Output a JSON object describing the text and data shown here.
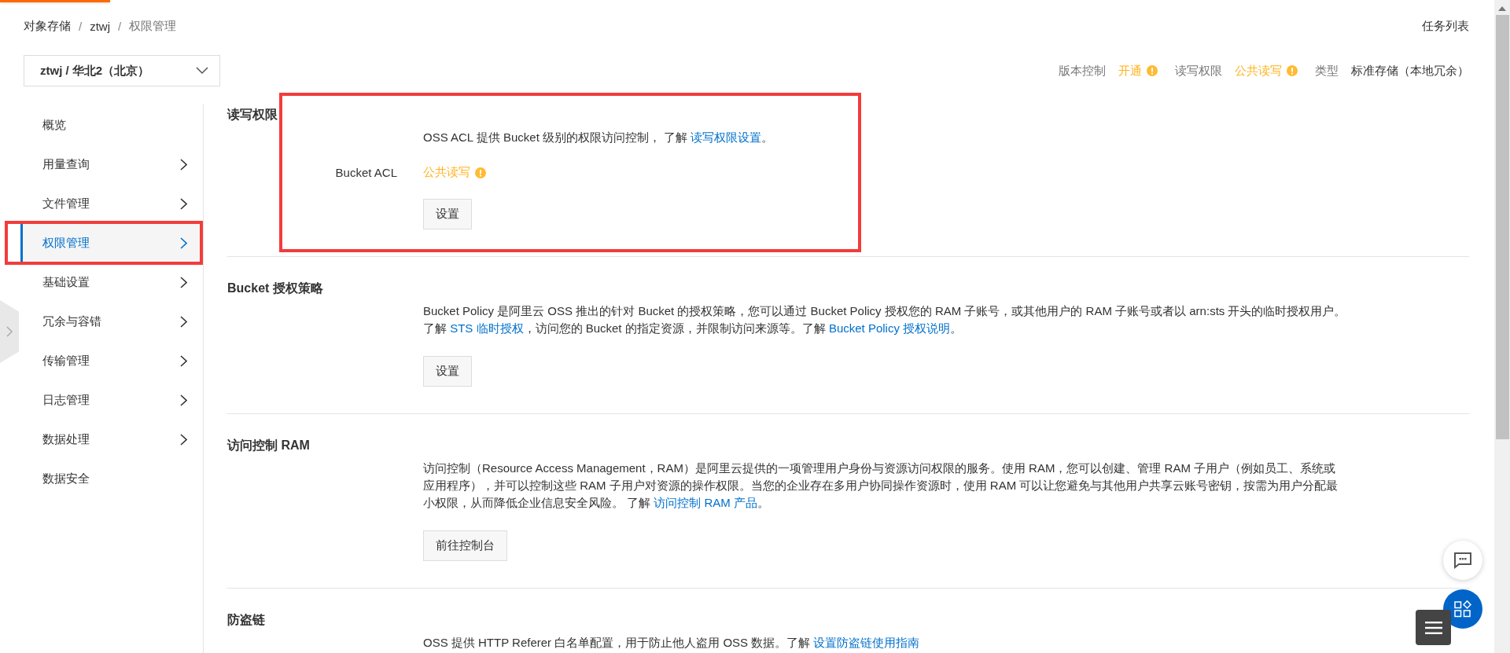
{
  "breadcrumb": {
    "separator": "/",
    "items": [
      "对象存储",
      "ztwj",
      "权限管理"
    ]
  },
  "task_list_link": "任务列表",
  "bucket_selector": {
    "value": "ztwj / 华北2（北京）"
  },
  "bucket_info": [
    {
      "label": "版本控制",
      "value": "开通",
      "warning": true
    },
    {
      "label": "读写权限",
      "value": "公共读写",
      "warning": true
    },
    {
      "label": "类型",
      "value": "标准存储（本地冗余）",
      "warning": false
    }
  ],
  "sidebar": {
    "items": [
      {
        "label": "概览",
        "has_children": false,
        "selected": false,
        "highlighted": false
      },
      {
        "label": "用量查询",
        "has_children": true,
        "selected": false,
        "highlighted": false
      },
      {
        "label": "文件管理",
        "has_children": true,
        "selected": false,
        "highlighted": false
      },
      {
        "label": "权限管理",
        "has_children": true,
        "selected": true,
        "highlighted": true
      },
      {
        "label": "基础设置",
        "has_children": true,
        "selected": false,
        "highlighted": false
      },
      {
        "label": "冗余与容错",
        "has_children": true,
        "selected": false,
        "highlighted": false
      },
      {
        "label": "传输管理",
        "has_children": true,
        "selected": false,
        "highlighted": false
      },
      {
        "label": "日志管理",
        "has_children": true,
        "selected": false,
        "highlighted": false
      },
      {
        "label": "数据处理",
        "has_children": true,
        "selected": false,
        "highlighted": false
      },
      {
        "label": "数据安全",
        "has_children": false,
        "selected": false,
        "highlighted": false
      }
    ]
  },
  "sections": [
    {
      "title": "读写权限",
      "highlighted": true,
      "description": [
        {
          "text": "OSS ACL 提供 Bucket 级别的权限访问控制， 了解 ",
          "link": false
        },
        {
          "text": "读写权限设置",
          "link": true
        },
        {
          "text": "。",
          "link": false
        }
      ],
      "field": {
        "label": "Bucket ACL",
        "value": "公共读写",
        "warning": true
      },
      "button": "设置"
    },
    {
      "title": "Bucket 授权策略",
      "highlighted": false,
      "description": [
        {
          "text": "Bucket Policy 是阿里云 OSS 推出的针对 Bucket 的授权策略，您可以通过 Bucket Policy 授权您的 RAM 子账号，或其他用户的 RAM 子账号或者以 arn:sts 开头的临时授权用户。了解 ",
          "link": false
        },
        {
          "text": "STS 临时授权",
          "link": true
        },
        {
          "text": "，访问您的 Bucket 的指定资源，并限制访问来源等。了解 ",
          "link": false
        },
        {
          "text": "Bucket Policy 授权说明",
          "link": true
        },
        {
          "text": "。",
          "link": false
        }
      ],
      "button": "设置"
    },
    {
      "title": "访问控制 RAM",
      "highlighted": false,
      "description": [
        {
          "text": "访问控制（Resource Access Management，RAM）是阿里云提供的一项管理用户身份与资源访问权限的服务。使用 RAM，您可以创建、管理 RAM 子用户（例如员工、系统或应用程序），并可以控制这些 RAM 子用户对资源的操作权限。当您的企业存在多用户协同操作资源时，使用 RAM 可以让您避免与其他用户共享云账号密钥，按需为用户分配最小权限，从而降低企业信息安全风险。 了解 ",
          "link": false
        },
        {
          "text": "访问控制 RAM 产品",
          "link": true
        },
        {
          "text": "。",
          "link": false
        }
      ],
      "button": "前往控制台"
    },
    {
      "title": "防盗链",
      "highlighted": false,
      "description": [
        {
          "text": "OSS 提供 HTTP Referer 白名单配置，用于防止他人盗用 OSS 数据。了解 ",
          "link": false
        },
        {
          "text": "设置防盗链使用指南",
          "link": true
        }
      ]
    }
  ]
}
